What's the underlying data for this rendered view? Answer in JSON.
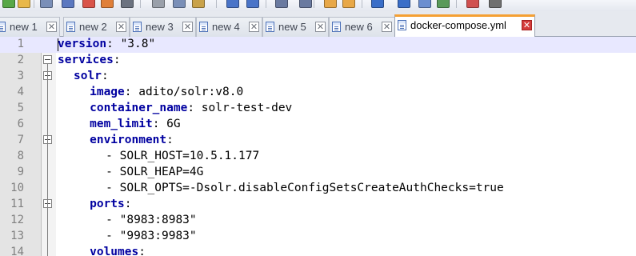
{
  "tabs": [
    {
      "label": "new 1",
      "active": false
    },
    {
      "label": "new 2",
      "active": false
    },
    {
      "label": "new 3",
      "active": false
    },
    {
      "label": "new 4",
      "active": false
    },
    {
      "label": "new 5",
      "active": false
    },
    {
      "label": "new 6",
      "active": false
    },
    {
      "label": "docker-compose.yml",
      "active": true
    }
  ],
  "tab_close_glyph": "✕",
  "toolbar": {
    "icons": [
      "new-file-icon",
      "open-file-icon",
      "save-icon",
      "save-all-icon",
      "close-icon",
      "close-all-icon",
      "print-icon",
      "cut-icon",
      "copy-icon",
      "paste-icon",
      "undo-icon",
      "redo-icon",
      "find-icon",
      "replace-icon",
      "zoom-in-icon",
      "zoom-out-icon",
      "sync-scroll-icon",
      "word-wrap-icon",
      "show-all-chars-icon",
      "indent-guide-icon",
      "macro-record-icon",
      "macro-stop-icon"
    ]
  },
  "editor": {
    "current_line": 1,
    "lines": [
      {
        "n": "1",
        "key": "version",
        "rest": ": \"3.8\"",
        "indent": 0
      },
      {
        "n": "2",
        "key": "services",
        "rest": ":",
        "indent": 0
      },
      {
        "n": "3",
        "key": "solr",
        "rest": ":",
        "indent": 2
      },
      {
        "n": "4",
        "key": "image",
        "rest": ": adito/solr:v8.0",
        "indent": 4
      },
      {
        "n": "5",
        "key": "container_name",
        "rest": ": solr-test-dev",
        "indent": 4
      },
      {
        "n": "6",
        "key": "mem_limit",
        "rest": ": 6G",
        "indent": 4
      },
      {
        "n": "7",
        "key": "environment",
        "rest": ":",
        "indent": 4
      },
      {
        "n": "8",
        "key": "",
        "rest": "- SOLR_HOST=10.5.1.177",
        "indent": 6
      },
      {
        "n": "9",
        "key": "",
        "rest": "- SOLR_HEAP=4G",
        "indent": 6
      },
      {
        "n": "10",
        "key": "",
        "rest": "- SOLR_OPTS=-Dsolr.disableConfigSetsCreateAuthChecks=true",
        "indent": 6
      },
      {
        "n": "11",
        "key": "ports",
        "rest": ":",
        "indent": 4
      },
      {
        "n": "12",
        "key": "",
        "rest": "- \"8983:8983\"",
        "indent": 6
      },
      {
        "n": "13",
        "key": "",
        "rest": "- \"9983:9983\"",
        "indent": 6
      },
      {
        "n": "14",
        "key": "volumes",
        "rest": ":",
        "indent": 4
      }
    ],
    "fold_lines": [
      "2",
      "3",
      "7",
      "11"
    ]
  },
  "colors": {
    "key": "#0000a0",
    "current_line_bg": "#e8e8ff",
    "active_tab_accent": "#f5a033",
    "close_active": "#d43c3c"
  }
}
